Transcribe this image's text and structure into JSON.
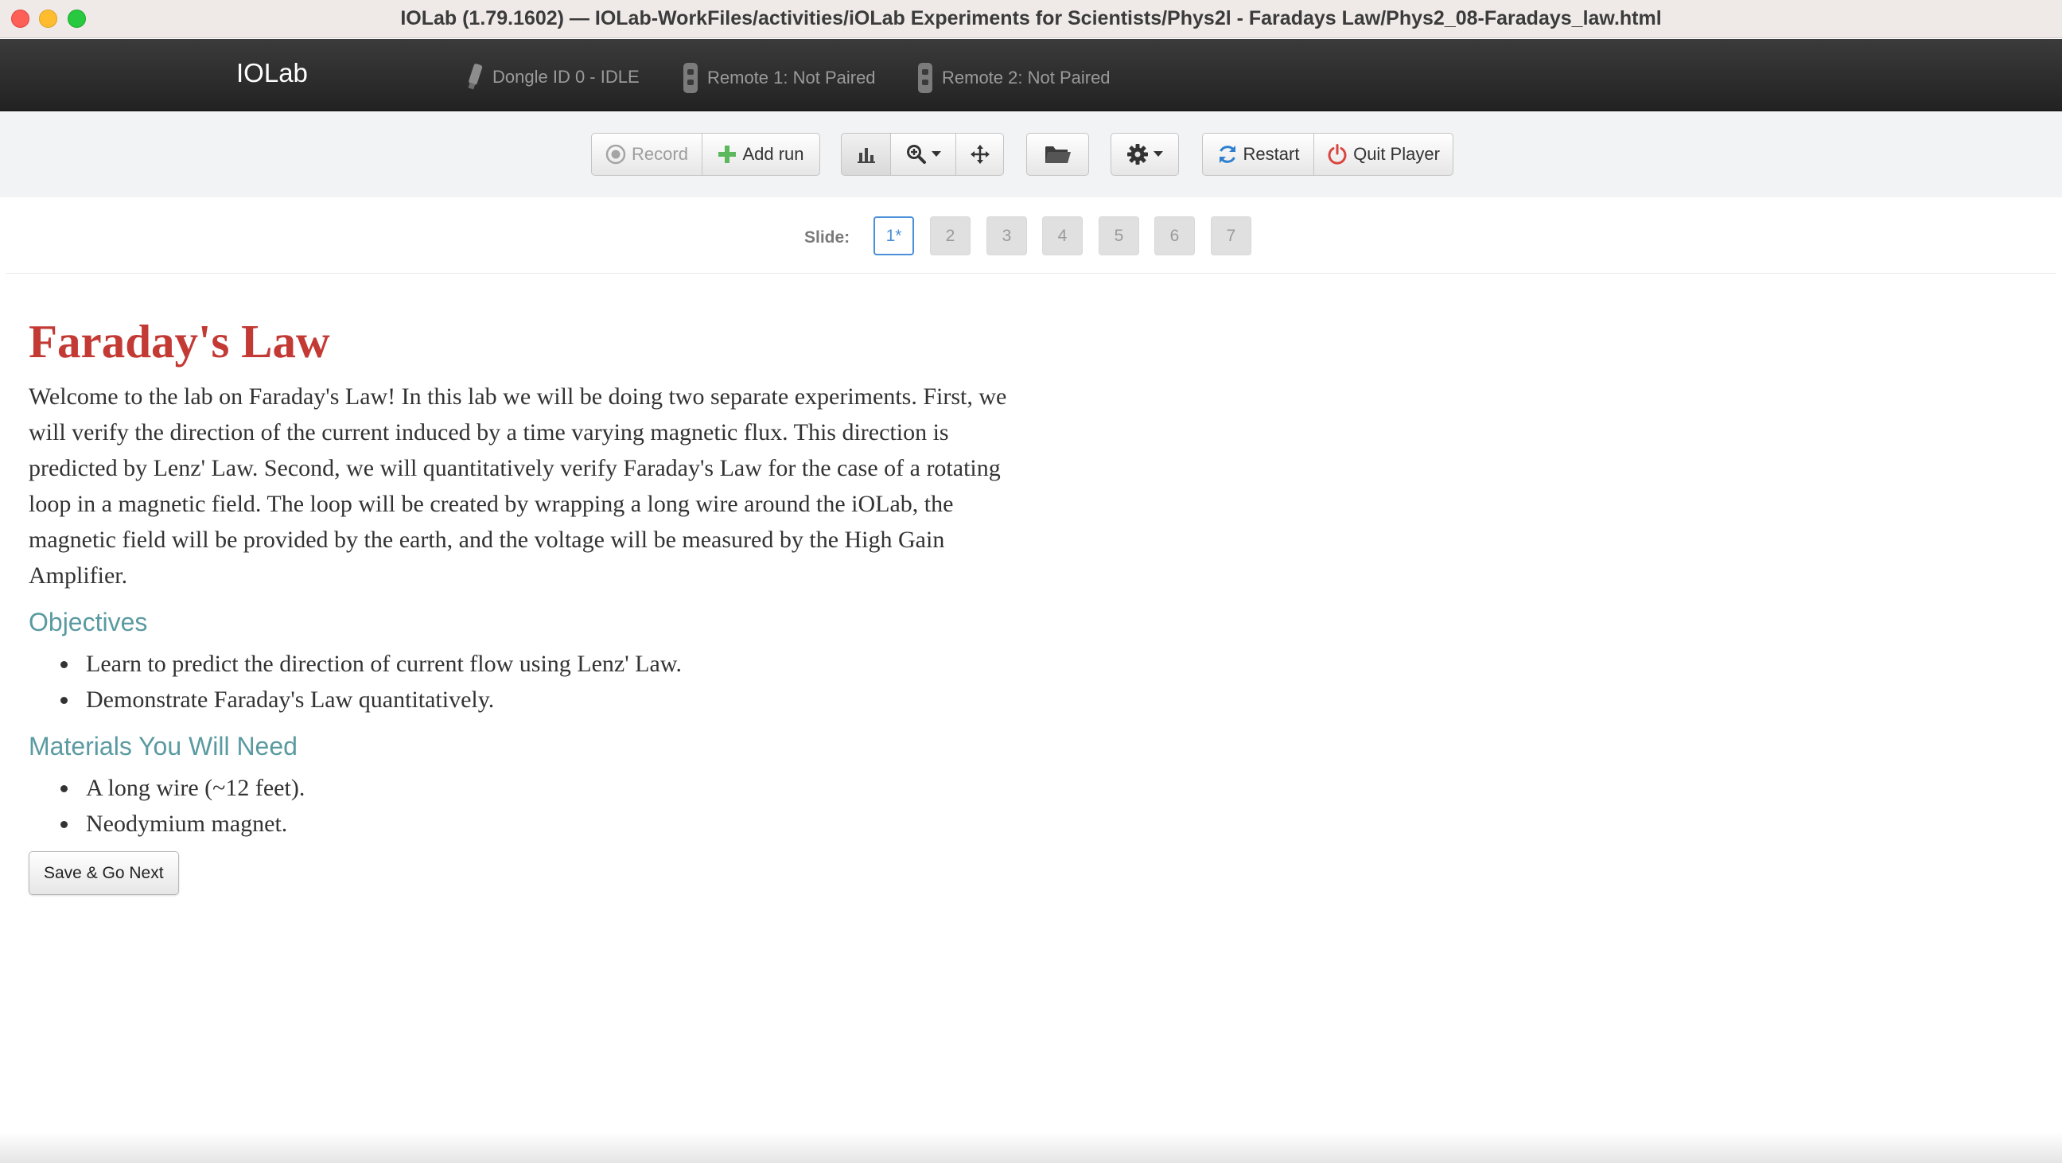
{
  "window": {
    "title": "IOLab (1.79.1602) — IOLab-WorkFiles/activities/iOLab Experiments for Scientists/Phys2l - Faradays Law/Phys2_08-Faradays_law.html"
  },
  "navbar": {
    "brand": "IOLab",
    "dongle": "Dongle ID 0 - IDLE",
    "remote1": "Remote 1: Not Paired",
    "remote2": "Remote 2: Not Paired"
  },
  "toolbar": {
    "record_label": "Record",
    "add_run_label": "Add run",
    "restart_label": "Restart",
    "quit_label": "Quit Player",
    "icons": [
      "record-icon",
      "plus-icon",
      "bar-chart-icon",
      "zoom-icon",
      "move-icon",
      "folder-icon",
      "gear-icon",
      "refresh-icon",
      "power-icon"
    ]
  },
  "slides": {
    "label": "Slide:",
    "items": [
      "1*",
      "2",
      "3",
      "4",
      "5",
      "6",
      "7"
    ],
    "active": "1*"
  },
  "content": {
    "title": "Faraday's Law",
    "intro": "Welcome to the lab on Faraday's Law! In this lab we will be doing two separate experiments. First, we will verify the direction of the current induced by a time varying magnetic flux. This direction is predicted by Lenz' Law. Second, we will quantitatively verify Faraday's Law for the case of a rotating loop in a magnetic field. The loop will be created by wrapping a long wire around the iOLab, the magnetic field will be provided by the earth, and the voltage will be measured by the High Gain Amplifier.",
    "objectives_heading": "Objectives",
    "objectives": [
      "Learn to predict the direction of current flow using Lenz' Law.",
      "Demonstrate Faraday's Law quantitatively."
    ],
    "materials_heading": "Materials You Will Need",
    "materials": [
      "A long wire (~12 feet).",
      "Neodymium magnet."
    ],
    "save_button": "Save & Go Next"
  },
  "colors": {
    "title_red": "#c33a35",
    "heading_teal": "#5a9aa1",
    "active_slide_blue": "#4a8fd9",
    "navbar_dark": "#2a2a2a"
  }
}
